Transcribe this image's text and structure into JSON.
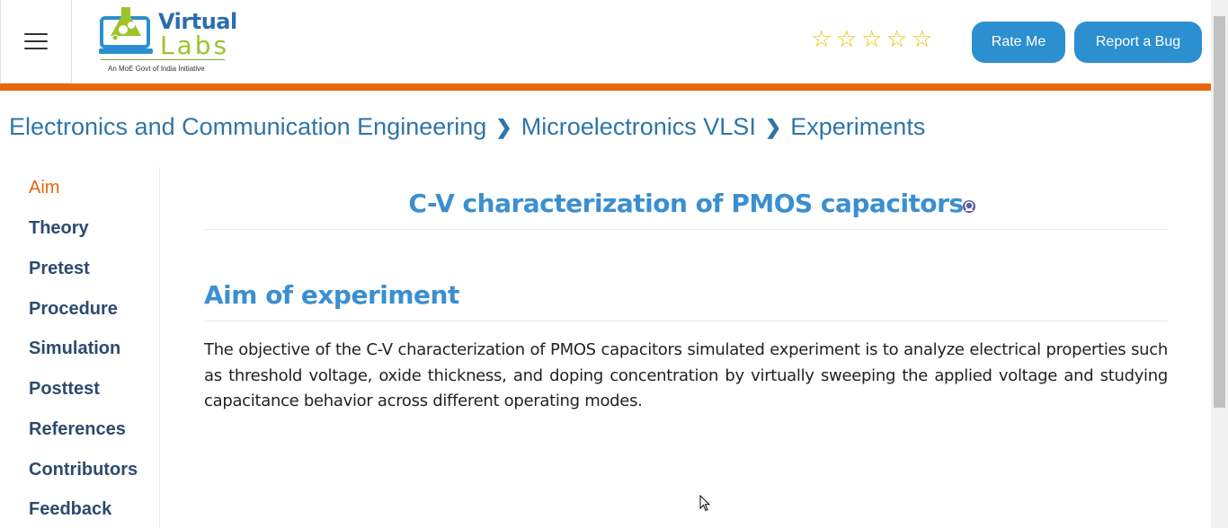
{
  "header": {
    "logo": {
      "line1": "Virtual",
      "line2": "Labs",
      "tagline": "An MoE Govt of India Initiative"
    },
    "rating": {
      "stars_filled": 0,
      "stars_total": 5
    },
    "rate_label": "Rate Me",
    "bug_label": "Report a Bug"
  },
  "breadcrumb": {
    "items": [
      "Electronics and Communication Engineering",
      "Microelectronics VLSI",
      "Experiments"
    ]
  },
  "sidebar": {
    "items": [
      {
        "label": "Aim",
        "active": true
      },
      {
        "label": "Theory"
      },
      {
        "label": "Pretest"
      },
      {
        "label": "Procedure"
      },
      {
        "label": "Simulation"
      },
      {
        "label": "Posttest"
      },
      {
        "label": "References"
      },
      {
        "label": "Contributors"
      },
      {
        "label": "Feedback"
      }
    ]
  },
  "main": {
    "title": "C-V characterization of PMOS capacitors",
    "aim_heading": "Aim of experiment",
    "aim_text": "The objective of the C-V characterization of PMOS capacitors simulated experiment is to analyze electrical properties such as threshold voltage, oxide thickness, and doping concentration by virtually sweeping the applied voltage and studying capacitance behavior across different operating modes."
  },
  "colors": {
    "accent_blue": "#2c8fd0",
    "orange": "#e8660e",
    "star": "#e6c200"
  }
}
